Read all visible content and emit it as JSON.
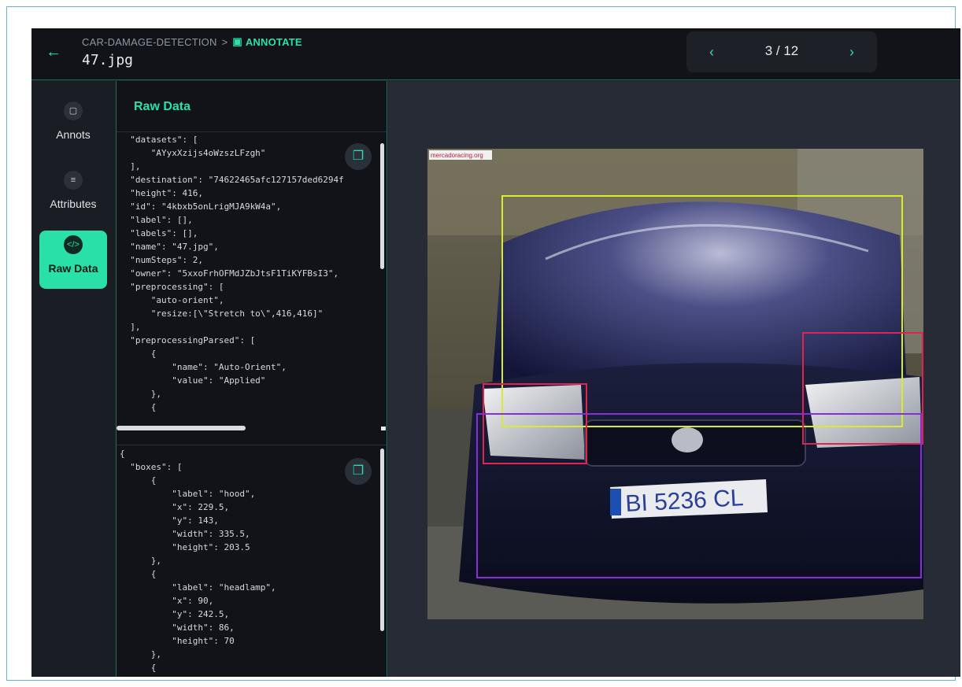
{
  "header": {
    "project": "CAR-DAMAGE-DETECTION",
    "separator": ">",
    "section": "ANNOTATE",
    "file_name": "47.jpg",
    "pager": "3 / 12"
  },
  "sidebar": {
    "items": [
      {
        "label": "Annots",
        "icon": "note-icon"
      },
      {
        "label": "Attributes",
        "icon": "list-icon"
      },
      {
        "label": "Raw Data",
        "icon": "code-icon",
        "active": true
      }
    ]
  },
  "raw_panel": {
    "title": "Raw Data",
    "top_json": "  \"datasets\": [\n      \"AYyxXzijs4oWzszLFzgh\"\n  ],\n  \"destination\": \"74622465afc127157ded6294f\n  \"height\": 416,\n  \"id\": \"4kbxb5onLrigMJA9kW4a\",\n  \"label\": [],\n  \"labels\": [],\n  \"name\": \"47.jpg\",\n  \"numSteps\": 2,\n  \"owner\": \"5xxoFrhOFMdJZbJtsF1TiKYFBsI3\",\n  \"preprocessing\": [\n      \"auto-orient\",\n      \"resize:[\\\"Stretch to\\\",416,416]\"\n  ],\n  \"preprocessingParsed\": [\n      {\n          \"name\": \"Auto-Orient\",\n          \"value\": \"Applied\"\n      },\n      {",
    "bottom_json": "{\n  \"boxes\": [\n      {\n          \"label\": \"hood\",\n          \"x\": 229.5,\n          \"y\": 143,\n          \"width\": 335.5,\n          \"height\": 203.5\n      },\n      {\n          \"label\": \"headlamp\",\n          \"x\": 90,\n          \"y\": 242.5,\n          \"width\": 86,\n          \"height\": 70\n      },\n      {"
  },
  "image": {
    "watermark": "mercadoracing.org",
    "plate": "BI 5236 CL"
  },
  "colors": {
    "accent": "#29e0a8",
    "hood_box": "#d8ec2a",
    "headlamp_box": "#e0244f",
    "bumper_box": "#8a2be2"
  }
}
